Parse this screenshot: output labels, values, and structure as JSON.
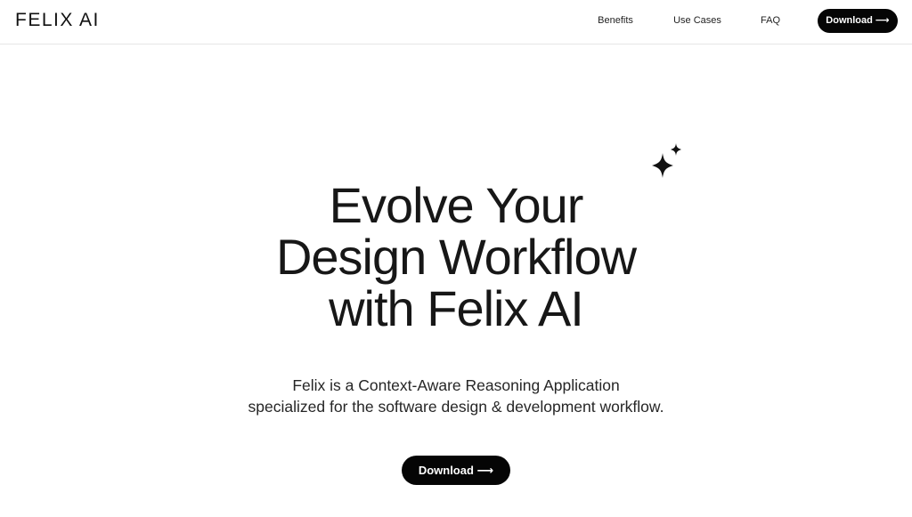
{
  "nav": {
    "brand": "FELIX AI",
    "links": [
      {
        "label": "Benefits"
      },
      {
        "label": "Use Cases"
      },
      {
        "label": "FAQ"
      }
    ],
    "download_label": "Download ⟶"
  },
  "hero": {
    "title_lines": [
      "Evolve Your",
      "Design Workflow",
      "with Felix AI"
    ],
    "subtitle_lines": [
      "Felix is a Context-Aware Reasoning Application",
      "specialized for the software design & development workflow."
    ],
    "download_label": "Download ⟶",
    "decoration_icon": "sparkles-icon"
  },
  "colors": {
    "accent": "#050505",
    "background": "#ffffff",
    "text": "#151515",
    "divider": "#e6e6e6"
  }
}
